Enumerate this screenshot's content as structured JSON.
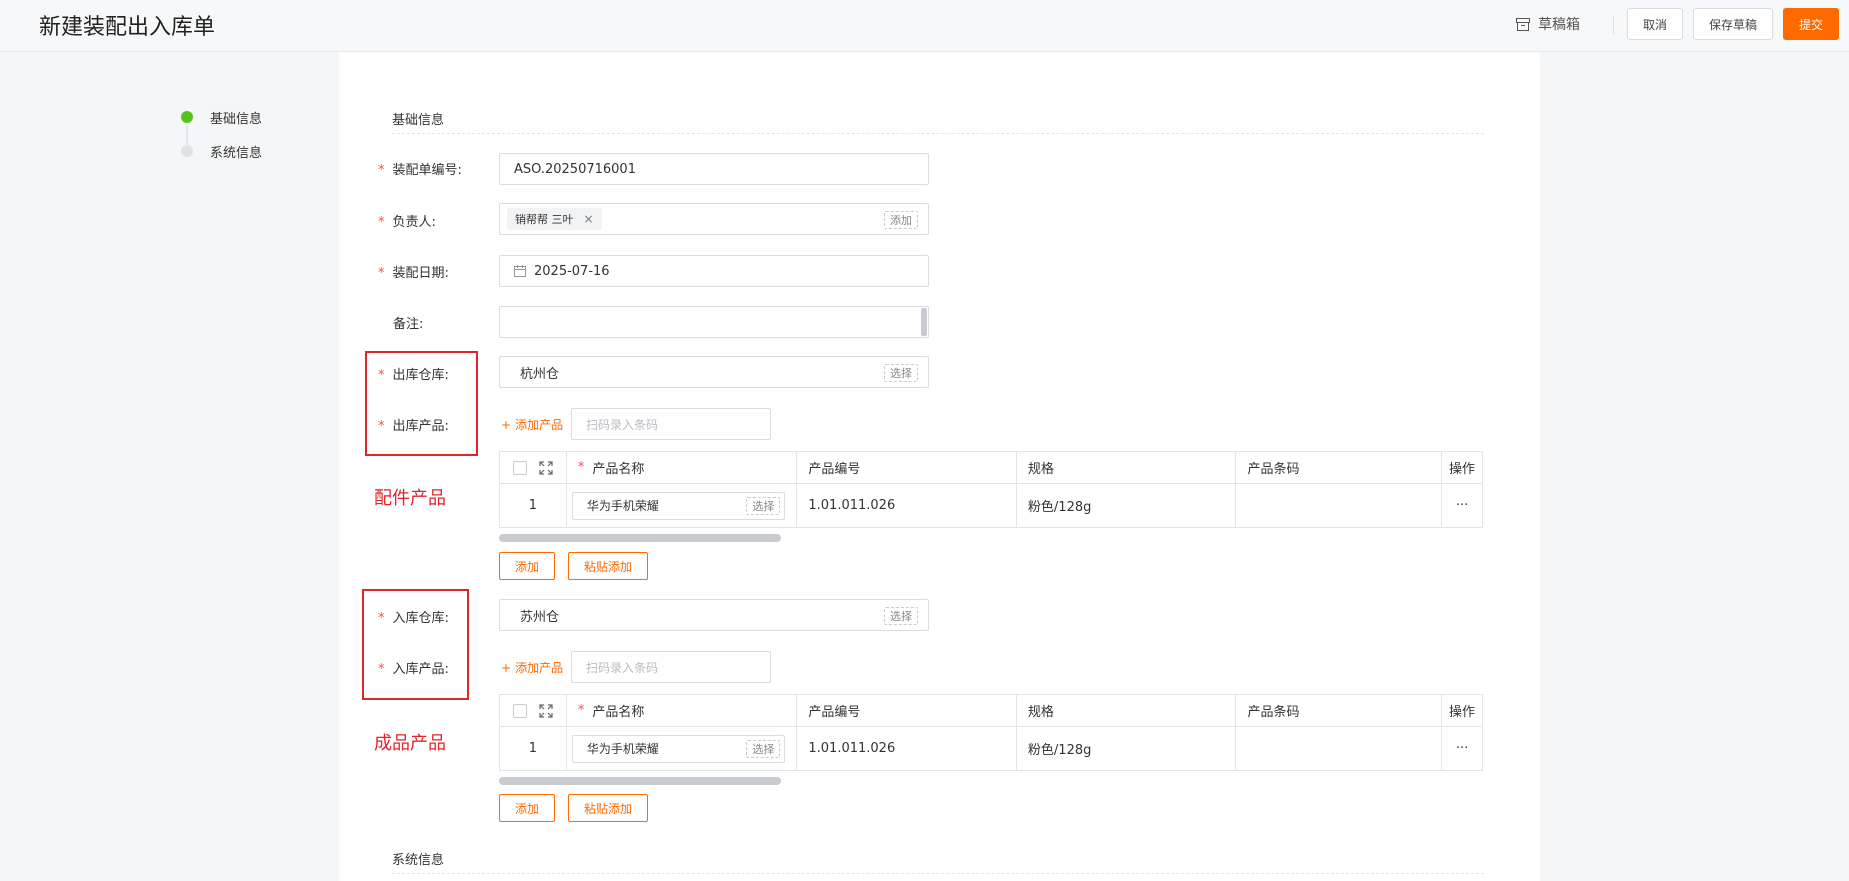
{
  "header": {
    "title": "新建装配出入库单",
    "draft_box": "草稿箱",
    "cancel": "取消",
    "save_draft": "保存草稿",
    "submit": "提交",
    "accent_color": "#ff6a00"
  },
  "steps": [
    {
      "label": "基础信息",
      "state": "active"
    },
    {
      "label": "系统信息",
      "state": "inactive"
    }
  ],
  "form": {
    "section_basic": "基础信息",
    "section_system": "系统信息",
    "order_no": {
      "label": "装配单编号:",
      "value": "ASO.20250716001"
    },
    "owner": {
      "label": "负责人:",
      "tag": "销帮帮 三叶",
      "add": "添加"
    },
    "date": {
      "label": "装配日期:",
      "value": "2025-07-16"
    },
    "remark": {
      "label": "备注:",
      "value": ""
    },
    "out_warehouse": {
      "label": "出库仓库:",
      "value": "杭州仓",
      "select": "选择"
    },
    "out_product": {
      "label": "出库产品:",
      "add_product": "添加产品",
      "scan_placeholder": "扫码录入条码"
    },
    "in_warehouse": {
      "label": "入库仓库:",
      "value": "苏州仓",
      "select": "选择"
    },
    "in_product": {
      "label": "入库产品:",
      "add_product": "添加产品",
      "scan_placeholder": "扫码录入条码"
    }
  },
  "table_columns": {
    "name": "产品名称",
    "code": "产品编号",
    "spec": "规格",
    "barcode": "产品条码",
    "op": "操作"
  },
  "out_table": {
    "rows": [
      {
        "index": "1",
        "name": "华为手机荣耀",
        "select": "选择",
        "code": "1.01.011.026",
        "spec": "粉色/128g",
        "barcode": "",
        "more": "···"
      }
    ],
    "add": "添加",
    "paste_add": "粘贴添加"
  },
  "in_table": {
    "rows": [
      {
        "index": "1",
        "name": "华为手机荣耀",
        "select": "选择",
        "code": "1.01.011.026",
        "spec": "粉色/128g",
        "barcode": "",
        "more": "···"
      }
    ],
    "add": "添加",
    "paste_add": "粘贴添加"
  },
  "annotations": {
    "parts": "配件产品",
    "finished": "成品产品",
    "color": "#e0252a"
  }
}
